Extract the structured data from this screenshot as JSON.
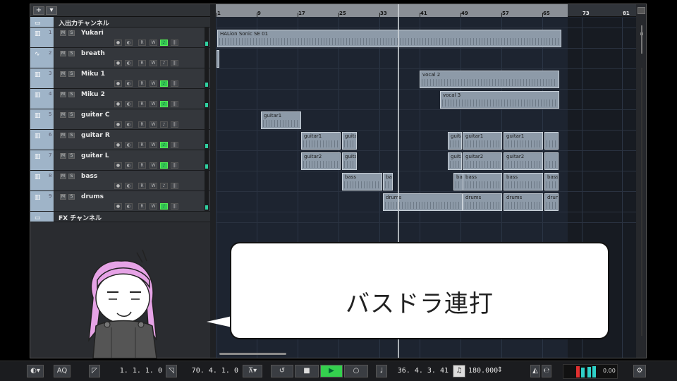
{
  "toolbar": {
    "add_label": "+",
    "menu_label": "▾"
  },
  "ruler": {
    "bars": [
      "1",
      "9",
      "17",
      "25",
      "33",
      "41",
      "49",
      "57",
      "65",
      "73",
      "81"
    ]
  },
  "tracks": [
    {
      "name": "入出力チャンネル",
      "type": "folder",
      "icon": "folder-icon"
    },
    {
      "num": "1",
      "name": "Yukari",
      "type": "instrument",
      "icon": "instrument-icon",
      "mute": "M",
      "solo": "S",
      "read": "R",
      "write": "W",
      "monitor_on": true
    },
    {
      "num": "2",
      "name": "breath",
      "type": "audio",
      "icon": "audio-wave-icon",
      "mute": "M",
      "solo": "S",
      "read": "R",
      "write": "W",
      "monitor_on": false
    },
    {
      "num": "3",
      "name": "Miku 1",
      "type": "instrument",
      "icon": "instrument-icon",
      "mute": "M",
      "solo": "S",
      "read": "R",
      "write": "W",
      "monitor_on": true
    },
    {
      "num": "4",
      "name": "Miku 2",
      "type": "instrument",
      "icon": "instrument-icon",
      "mute": "M",
      "solo": "S",
      "read": "R",
      "write": "W",
      "monitor_on": true
    },
    {
      "num": "5",
      "name": "guitar C",
      "type": "instrument",
      "icon": "instrument-icon",
      "mute": "M",
      "solo": "S",
      "read": "R",
      "write": "W",
      "monitor_on": false
    },
    {
      "num": "6",
      "name": "guitar R",
      "type": "instrument",
      "icon": "instrument-icon",
      "mute": "M",
      "solo": "S",
      "read": "R",
      "write": "W",
      "monitor_on": true
    },
    {
      "num": "7",
      "name": "guitar L",
      "type": "instrument",
      "icon": "instrument-icon",
      "mute": "M",
      "solo": "S",
      "read": "R",
      "write": "W",
      "monitor_on": true
    },
    {
      "num": "8",
      "name": "bass",
      "type": "instrument",
      "icon": "instrument-icon",
      "mute": "M",
      "solo": "S",
      "read": "R",
      "write": "W",
      "monitor_on": false
    },
    {
      "num": "9",
      "name": "drums",
      "type": "instrument",
      "icon": "instrument-icon",
      "mute": "M",
      "solo": "S",
      "read": "R",
      "write": "W",
      "monitor_on": true
    },
    {
      "name": "FX チャンネル",
      "type": "folder",
      "icon": "folder-icon"
    }
  ],
  "clips": [
    {
      "track": 1,
      "label": "HALion Sonic SE 01"
    },
    {
      "track": 2,
      "label": ""
    },
    {
      "track": 3,
      "label": "vocal 2"
    },
    {
      "track": 4,
      "label": "vocal 3"
    },
    {
      "track": 5,
      "label": "guitar1"
    },
    {
      "track": 6,
      "label": "guitar1"
    },
    {
      "track": 6,
      "label": "guita"
    },
    {
      "track": 6,
      "label": "guita"
    },
    {
      "track": 6,
      "label": "guitar1"
    },
    {
      "track": 6,
      "label": "guitar1"
    },
    {
      "track": 6,
      "label": ""
    },
    {
      "track": 7,
      "label": "guitar2"
    },
    {
      "track": 7,
      "label": "guita"
    },
    {
      "track": 7,
      "label": "guita"
    },
    {
      "track": 7,
      "label": "guitar2"
    },
    {
      "track": 7,
      "label": "guitar2"
    },
    {
      "track": 7,
      "label": ""
    },
    {
      "track": 8,
      "label": "bass"
    },
    {
      "track": 8,
      "label": "ba"
    },
    {
      "track": 8,
      "label": "ba"
    },
    {
      "track": 8,
      "label": "bass"
    },
    {
      "track": 8,
      "label": "bass"
    },
    {
      "track": 8,
      "label": "bass"
    },
    {
      "track": 9,
      "label": "drums"
    },
    {
      "track": 9,
      "label": "drums"
    },
    {
      "track": 9,
      "label": "drums"
    },
    {
      "track": 9,
      "label": "drun"
    }
  ],
  "bubble": {
    "text": "バスドラ連打"
  },
  "transport": {
    "aq_label": "AQ",
    "left_locator": "1. 1. 1.  0",
    "right_locator": "70. 4. 1.  0",
    "position": "36. 4. 3. 41",
    "tempo": "180.000",
    "meter_value": "0.00"
  },
  "colors": {
    "track_color": "#9fb4c8",
    "monitor_green": "#35c653",
    "play_green": "#34d04e",
    "clip_fill": "#8d9aa8"
  }
}
